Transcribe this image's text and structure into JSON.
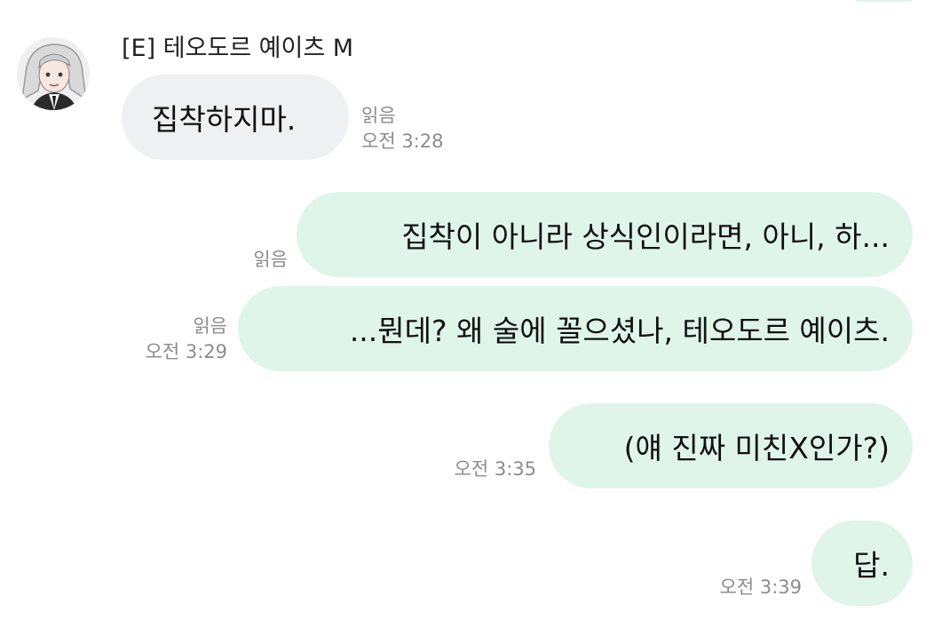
{
  "chat": {
    "sender_name": "[E] 테오도르 예이츠 M",
    "messages": [
      {
        "direction": "incoming",
        "text": "집착하지마.",
        "read_label": "읽음",
        "time": "오전 3:28"
      },
      {
        "direction": "outgoing",
        "text": "집착이 아니라 상식인이라면, 아니, 하...",
        "read_label": "읽음",
        "time": ""
      },
      {
        "direction": "outgoing",
        "text": "...뭔데? 왜 술에 꼴으셨나, 테오도르 예이츠.",
        "read_label": "읽음",
        "time": "오전 3:29"
      },
      {
        "direction": "outgoing",
        "text": "(얘 진짜 미친X인가?)",
        "read_label": "",
        "time": "오전 3:35"
      },
      {
        "direction": "outgoing",
        "text": "답.",
        "read_label": "",
        "time": "오전 3:39"
      }
    ]
  },
  "colors": {
    "incoming_bubble": "#eff0f2",
    "outgoing_bubble": "#dff5ea",
    "meta_text": "#8c8c8c"
  }
}
